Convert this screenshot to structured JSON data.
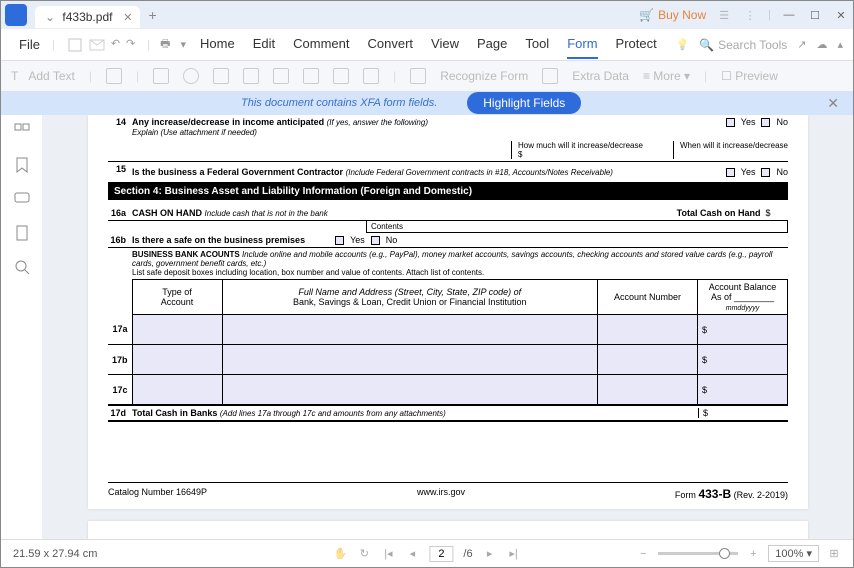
{
  "tab": {
    "name": "f433b.pdf"
  },
  "titlebar": {
    "buy_now": "Buy Now"
  },
  "menu": {
    "file": "File",
    "tabs": [
      "Home",
      "Edit",
      "Comment",
      "Convert",
      "View",
      "Page",
      "Tool",
      "Form",
      "Protect"
    ],
    "active": "Form",
    "search_placeholder": "Search Tools"
  },
  "toolbar": {
    "add_text": "Add Text",
    "recognize": "Recognize Form",
    "extra_data": "Extra Data",
    "more": "More",
    "preview": "Preview"
  },
  "banner": {
    "text": "This document contains XFA form fields.",
    "button": "Highlight Fields"
  },
  "form": {
    "r14": {
      "num": "14",
      "label": "Any increase/decrease in income anticipated",
      "hint": "(If yes, answer the following)",
      "explain": "Explain (Use attachment if needed)",
      "amount_label": "How much will it increase/decrease",
      "when_label": "When will it increase/decrease",
      "yes": "Yes",
      "no": "No"
    },
    "r15": {
      "num": "15",
      "label": "Is the business a Federal Government Contractor",
      "hint": "(Include Federal Government contracts in #18, Accounts/Notes Receivable)",
      "yes": "Yes",
      "no": "No"
    },
    "section4": "Section 4: Business Asset and Liability Information (Foreign and Domestic)",
    "r16a": {
      "num": "16a",
      "label": "CASH ON HAND",
      "hint": "Include cash that is not in the bank",
      "total": "Total Cash on Hand"
    },
    "contents": "Contents",
    "r16b": {
      "num": "16b",
      "label": "Is there a safe on the business premises",
      "yes": "Yes",
      "no": "No"
    },
    "bank_header": {
      "bold": "BUSINESS BANK ACOUNTS",
      "desc": "Include online and mobile accounts (e.g., PayPal), money market accounts, savings accounts, checking accounts and stored value cards (e.g., payroll cards, government benefit cards, etc.)",
      "list": "List safe deposit boxes including location, box number and value of contents. Attach list of contents."
    },
    "table": {
      "h1a": "Type of",
      "h1b": "Account",
      "h2a": "Full Name and Address (Street, City, State, ZIP code) of",
      "h2b": "Bank, Savings & Loan, Credit Union or Financial Institution",
      "h3": "Account Number",
      "h4a": "Account Balance",
      "h4b": "As of",
      "h4c": "mmddyyyy",
      "rows": [
        "17a",
        "17b",
        "17c"
      ]
    },
    "r17d": {
      "num": "17d",
      "label": "Total Cash in Banks",
      "hint": "(Add lines 17a through 17c and amounts from any attachments)"
    },
    "footer": {
      "catalog": "Catalog Number 16649P",
      "url": "www.irs.gov",
      "form_pre": "Form",
      "form_num": "433-B",
      "rev": "(Rev. 2-2019)"
    }
  },
  "statusbar": {
    "dims": "21.59 x 27.94 cm",
    "page": "2",
    "total": "/6",
    "zoom": "100%"
  }
}
